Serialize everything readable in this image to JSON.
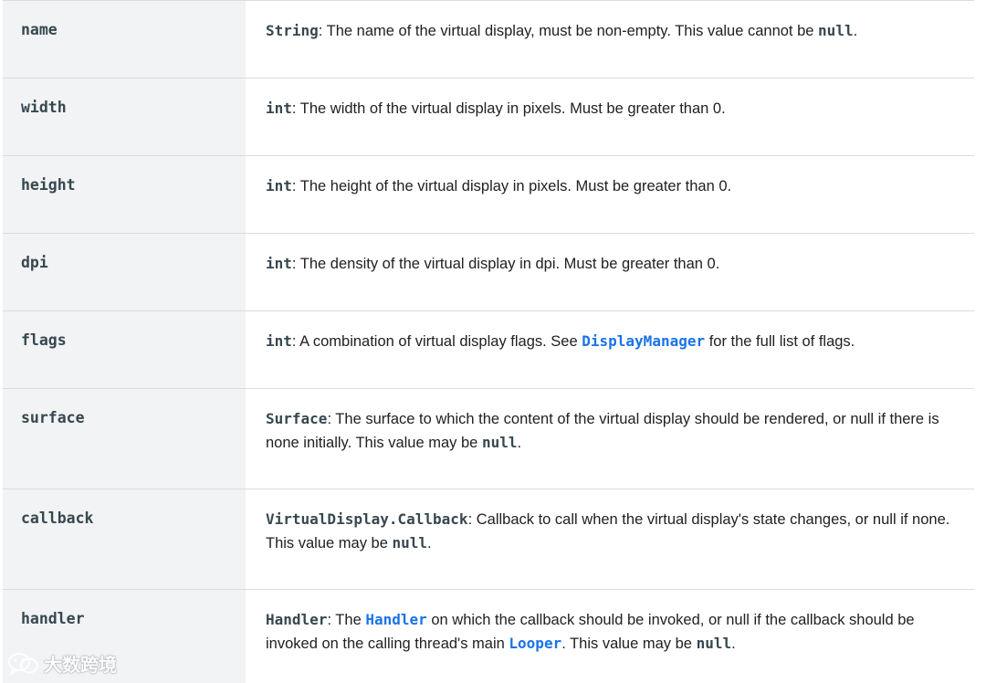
{
  "rows": [
    {
      "name": "name",
      "desc": [
        {
          "t": "String",
          "k": "code"
        },
        {
          "t": ": The name of the virtual display, must be non-empty. This value cannot be ",
          "k": "text"
        },
        {
          "t": "null",
          "k": "code"
        },
        {
          "t": ".",
          "k": "text"
        }
      ]
    },
    {
      "name": "width",
      "desc": [
        {
          "t": "int",
          "k": "code"
        },
        {
          "t": ": The width of the virtual display in pixels. Must be greater than 0.",
          "k": "text"
        }
      ]
    },
    {
      "name": "height",
      "desc": [
        {
          "t": "int",
          "k": "code"
        },
        {
          "t": ": The height of the virtual display in pixels. Must be greater than 0.",
          "k": "text"
        }
      ]
    },
    {
      "name": "dpi",
      "desc": [
        {
          "t": "int",
          "k": "code"
        },
        {
          "t": ": The density of the virtual display in dpi. Must be greater than 0.",
          "k": "text"
        }
      ]
    },
    {
      "name": "flags",
      "desc": [
        {
          "t": "int",
          "k": "code"
        },
        {
          "t": ": A combination of virtual display flags. See ",
          "k": "text"
        },
        {
          "t": "DisplayManager",
          "k": "link"
        },
        {
          "t": " for the full list of flags.",
          "k": "text"
        }
      ]
    },
    {
      "name": "surface",
      "desc": [
        {
          "t": "Surface",
          "k": "code"
        },
        {
          "t": ": The surface to which the content of the virtual display should be rendered, or null if there is none initially. This value may be ",
          "k": "text"
        },
        {
          "t": "null",
          "k": "code"
        },
        {
          "t": ".",
          "k": "text"
        }
      ]
    },
    {
      "name": "callback",
      "desc": [
        {
          "t": "VirtualDisplay.Callback",
          "k": "code"
        },
        {
          "t": ": Callback to call when the virtual display's state changes, or null if none. This value may be ",
          "k": "text"
        },
        {
          "t": "null",
          "k": "code"
        },
        {
          "t": ".",
          "k": "text"
        }
      ]
    },
    {
      "name": "handler",
      "desc": [
        {
          "t": "Handler",
          "k": "code"
        },
        {
          "t": ": The ",
          "k": "text"
        },
        {
          "t": "Handler",
          "k": "link"
        },
        {
          "t": " on which the callback should be invoked, or null if the callback should be invoked on the calling thread's main ",
          "k": "text"
        },
        {
          "t": "Looper",
          "k": "link"
        },
        {
          "t": ". This value may be ",
          "k": "text"
        },
        {
          "t": "null",
          "k": "code"
        },
        {
          "t": ".",
          "k": "text"
        }
      ]
    }
  ],
  "watermark": {
    "text": "大数跨境",
    "icon": "wechat-logo-icon"
  }
}
